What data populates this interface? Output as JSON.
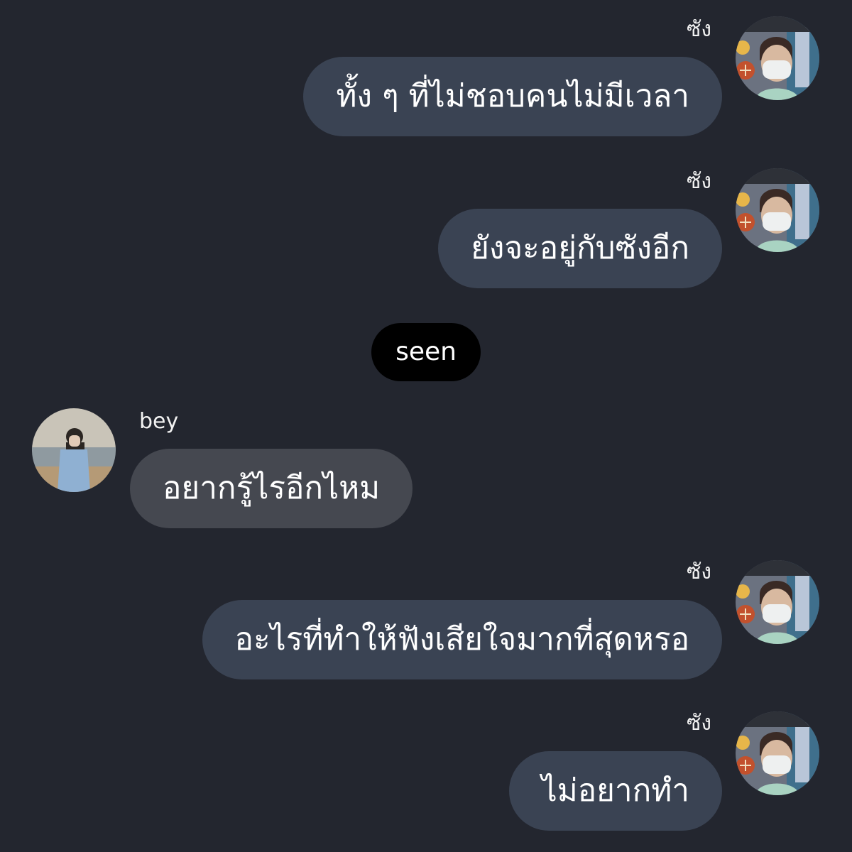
{
  "messages": [
    {
      "sender": "ซัง",
      "text": "ทั้ง ๆ ที่ไม่ชอบคนไม่มีเวลา",
      "side": "right",
      "avatar_icon": "profile-photo-masked-person"
    },
    {
      "sender": "ซัง",
      "text": "ยังจะอยู่กับซังอีก",
      "side": "right",
      "avatar_icon": "profile-photo-masked-person"
    },
    {
      "sender": "bey",
      "text": "อยากรู้ไรอีกไหม",
      "side": "left",
      "avatar_icon": "profile-photo-beach-person"
    },
    {
      "sender": "ซัง",
      "text": "อะไรที่ทำให้ฟังเสียใจมากที่สุดหรอ",
      "side": "right",
      "avatar_icon": "profile-photo-masked-person"
    },
    {
      "sender": "ซัง",
      "text": "ไม่อยากทำ",
      "side": "right",
      "avatar_icon": "profile-photo-masked-person"
    }
  ],
  "seen_indicator": "seen",
  "colors": {
    "background": "#23262f",
    "sent_bubble": "#3a4353",
    "received_bubble": "#454850",
    "seen_pill": "#000000",
    "text": "#ffffff"
  }
}
